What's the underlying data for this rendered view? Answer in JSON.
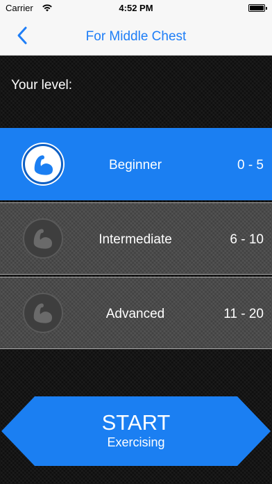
{
  "status_bar": {
    "carrier": "Carrier",
    "time": "4:52 PM",
    "battery_level": 1.0
  },
  "nav": {
    "title": "For Middle Chest",
    "back_icon": "chevron-left-icon"
  },
  "level_label": "Your level:",
  "levels": [
    {
      "name": "Beginner",
      "range": "0 - 5",
      "selected": true,
      "icon": "flexed-arm-icon"
    },
    {
      "name": "Intermediate",
      "range": "6 - 10",
      "selected": false,
      "icon": "flexed-arm-icon"
    },
    {
      "name": "Advanced",
      "range": "11 - 20",
      "selected": false,
      "icon": "flexed-arm-icon"
    }
  ],
  "start": {
    "label": "START",
    "sublabel": "Exercising"
  },
  "colors": {
    "accent": "#1b7ff2",
    "nav_title": "#1e7ef7",
    "background": "#141414",
    "row_inactive": "#4a4a4a"
  }
}
